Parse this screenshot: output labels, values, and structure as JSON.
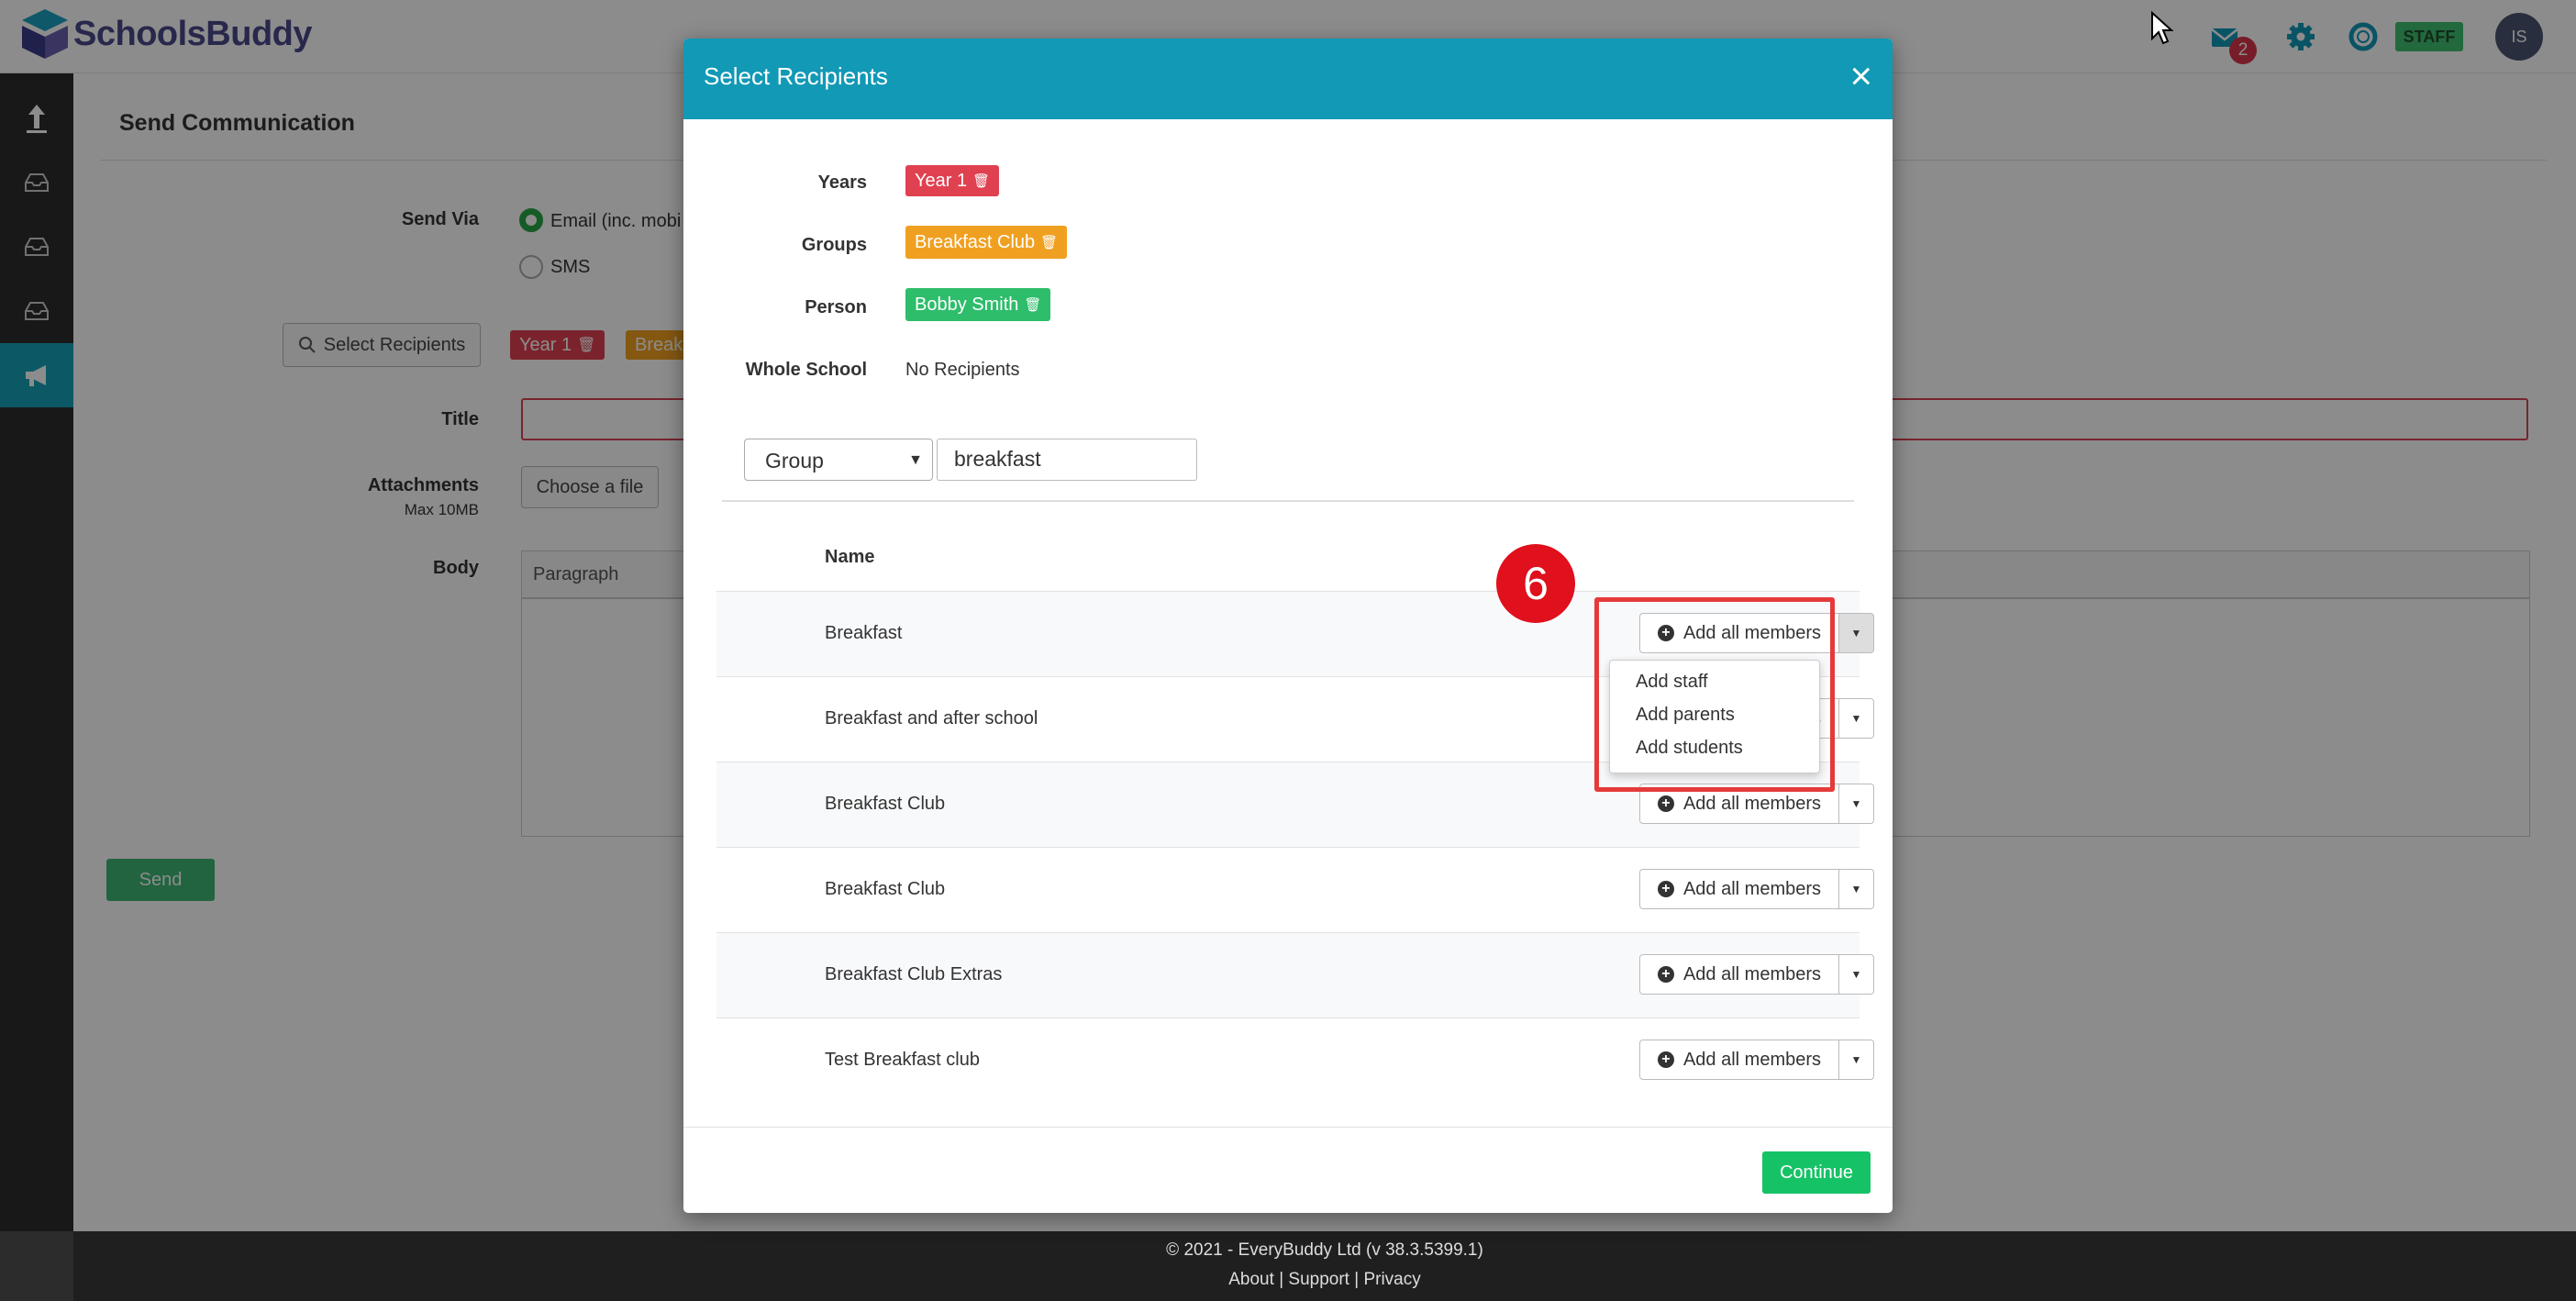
{
  "app": {
    "name": "SchoolsBuddy"
  },
  "topbar": {
    "mail_badge": "2",
    "staff_label": "STAFF",
    "avatar_initials": "IS"
  },
  "page": {
    "title": "Send Communication",
    "send_via_label": "Send Via",
    "send_via_options": [
      "Email (inc. mobi",
      "SMS"
    ],
    "select_recipients_label": "Select Recipients",
    "chips": [
      "Year 1",
      "Breakf"
    ],
    "title_label": "Title",
    "attachments_label": "Attachments",
    "attachments_sub": "Max 10MB",
    "choose_file_label": "Choose a file",
    "body_label": "Body",
    "paragraph_label": "Paragraph",
    "send_label": "Send"
  },
  "footer": {
    "copyright": "© 2021 - EveryBuddy Ltd (v 38.3.5399.1)",
    "links": [
      "About",
      "Support",
      "Privacy"
    ]
  },
  "modal": {
    "title": "Select Recipients",
    "close": "×",
    "years_label": "Years",
    "years_tag": "Year 1",
    "groups_label": "Groups",
    "groups_tag": "Breakfast Club",
    "person_label": "Person",
    "person_tag": "Bobby Smith",
    "whole_school_label": "Whole School",
    "whole_school_value": "No Recipients",
    "filter_type": "Group",
    "search_value": "breakfast",
    "column_name": "Name",
    "rows": [
      "Breakfast",
      "Breakfast and after school",
      "Breakfast Club",
      "Breakfast Club",
      "Breakfast Club Extras",
      "Test Breakfast club"
    ],
    "add_all_label": "Add all members",
    "dropdown_items": [
      "Add staff",
      "Add parents",
      "Add students"
    ],
    "step_number": "6",
    "continue_label": "Continue"
  },
  "colors": {
    "header_teal": "#1199b6",
    "sidebar_active": "#17a2b8",
    "tag_red": "#e04150",
    "tag_orange": "#f0a020",
    "tag_green": "#2ebd6b",
    "continue_green": "#16c266",
    "highlight_red": "#e53a3a"
  }
}
